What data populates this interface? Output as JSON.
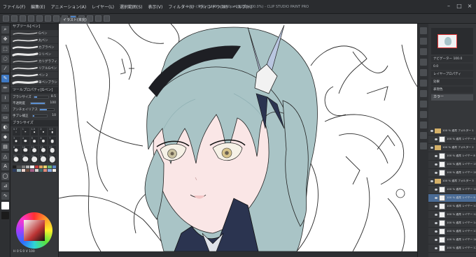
{
  "app": {
    "title": "イラスト(未完) (3840 x 2160px 350dpi 100.0%) - CLIP STUDIO PAINT PRO"
  },
  "menu": [
    "ファイル(F)",
    "編集(E)",
    "アニメーション(A)",
    "レイヤー(L)",
    "選択範囲(S)",
    "表示(V)",
    "フィルター(I)",
    "ウィンドウ(W)",
    "ヘルプ(H)"
  ],
  "canvas_tab": "イラスト(未完)",
  "left_panel": {
    "tab_label": "サブツール[ペン]",
    "brushes": [
      {
        "label": "Gペン"
      },
      {
        "label": "丸ペン"
      },
      {
        "label": "カブラペン"
      },
      {
        "label": "ミリペン"
      },
      {
        "label": "カリグラフィ"
      },
      {
        "label": "リアルGペン"
      },
      {
        "label": "ペン 2"
      },
      {
        "label": "筆ペンブラシ"
      }
    ],
    "prop_tab": "ツールプロパティ[Gペン]",
    "props": [
      {
        "label": "ブラシサイズ",
        "value": "8.5",
        "level": 0.2
      },
      {
        "label": "不透明度",
        "value": "100",
        "level": 1.0
      },
      {
        "label": "アンチエイリアス",
        "value": "",
        "level": 0.5
      },
      {
        "label": "手ブレ補正",
        "value": "10",
        "level": 0.1
      }
    ],
    "size_tab": "ブラシサイズ",
    "sizes": [
      "0.7",
      "1",
      "1.5",
      "2",
      "2.5",
      "3",
      "4",
      "5",
      "6",
      "7",
      "8",
      "10",
      "12",
      "15",
      "17",
      "20",
      "25",
      "30",
      "40",
      "50"
    ],
    "swatch_colors": [
      "#1e1e1e",
      "#4a4a4a",
      "#7d7d7d",
      "#b0b0b0",
      "#ffffff",
      "#c23b3b",
      "#e0a15e",
      "#e8d36a",
      "#6db36d",
      "#5b86c5",
      "#2b3a5c",
      "#9ab8c2",
      "#f2d7d0",
      "#6b4a3a",
      "#a35e86",
      "#d4d4d4",
      "#3d6e6e",
      "#e38a7a",
      "#8aa8e0",
      "#f5f0e6"
    ],
    "color_values": "H 0  S 0  V 100",
    "current_color": "#ffffff"
  },
  "right_panel": {
    "navigator_label": "ナビゲーター",
    "zoom": "100.0",
    "angle": "0.0",
    "layer_prop_tab": "レイヤープロパティ",
    "tone_label": "効果",
    "blend_label": "表現色",
    "blend_value": "カラー",
    "layers": [
      {
        "text": "100 % 通常 フォルダー 1",
        "folder": true,
        "sel": false,
        "ind": false
      },
      {
        "text": "100 % 通常 レイヤー 6",
        "folder": false,
        "sel": false,
        "ind": true
      },
      {
        "text": "100 % 通常 フォルダー 2",
        "folder": true,
        "sel": false,
        "ind": false
      },
      {
        "text": "100 % 通常 レイヤー 8",
        "folder": false,
        "sel": false,
        "ind": true
      },
      {
        "text": "100 % 通常 レイヤー 15",
        "folder": false,
        "sel": false,
        "ind": true
      },
      {
        "text": "100 % 通常 レイヤー 20",
        "folder": false,
        "sel": false,
        "ind": true
      },
      {
        "text": "100 % 通常 フォルダー 3",
        "folder": true,
        "sel": false,
        "ind": false
      },
      {
        "text": "100 % 通常 レイヤー 10",
        "folder": false,
        "sel": false,
        "ind": true
      },
      {
        "text": "100 % 通常 レイヤー 9",
        "folder": false,
        "sel": true,
        "ind": true
      },
      {
        "text": "100 % 通常 レイヤー 11",
        "folder": false,
        "sel": false,
        "ind": true
      },
      {
        "text": "100 % 通常 レイヤー 12",
        "folder": false,
        "sel": false,
        "ind": true
      },
      {
        "text": "100 % 通常 レイヤー 14",
        "folder": false,
        "sel": false,
        "ind": true
      },
      {
        "text": "100 % 通常 レイヤー 13",
        "folder": false,
        "sel": false,
        "ind": true
      },
      {
        "text": "100 % 通常 レイヤー 16",
        "folder": false,
        "sel": false,
        "ind": true
      },
      {
        "text": "100 % 通常 レイヤー 17",
        "folder": false,
        "sel": false,
        "ind": true
      }
    ]
  },
  "colors": {
    "hair": "#a9c4c6",
    "hair_shade": "#8fb0b3",
    "skin": "#fae6e6",
    "outfit": "#2b3450",
    "hairband": "#1e1f24",
    "ornament": "#b9c6e0",
    "accent": "#3d78c4"
  }
}
